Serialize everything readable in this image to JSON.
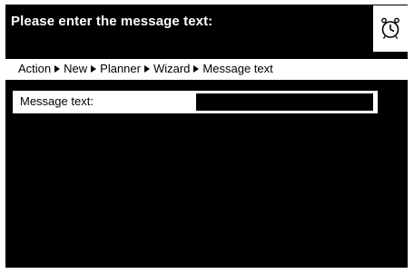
{
  "header": {
    "title": "Please enter the message text:",
    "icon": "timer-clock-icon"
  },
  "breadcrumb": {
    "items": [
      "Action",
      "New",
      "Planner",
      "Wizard",
      "Message text"
    ],
    "separator_icon": "triangle-right-icon"
  },
  "form": {
    "message_label": "Message text:",
    "message_value": ""
  },
  "colors": {
    "screen_background": "#000000",
    "bar_background": "#ffffff",
    "text_on_dark": "#ffffff",
    "text_on_light": "#000000"
  }
}
